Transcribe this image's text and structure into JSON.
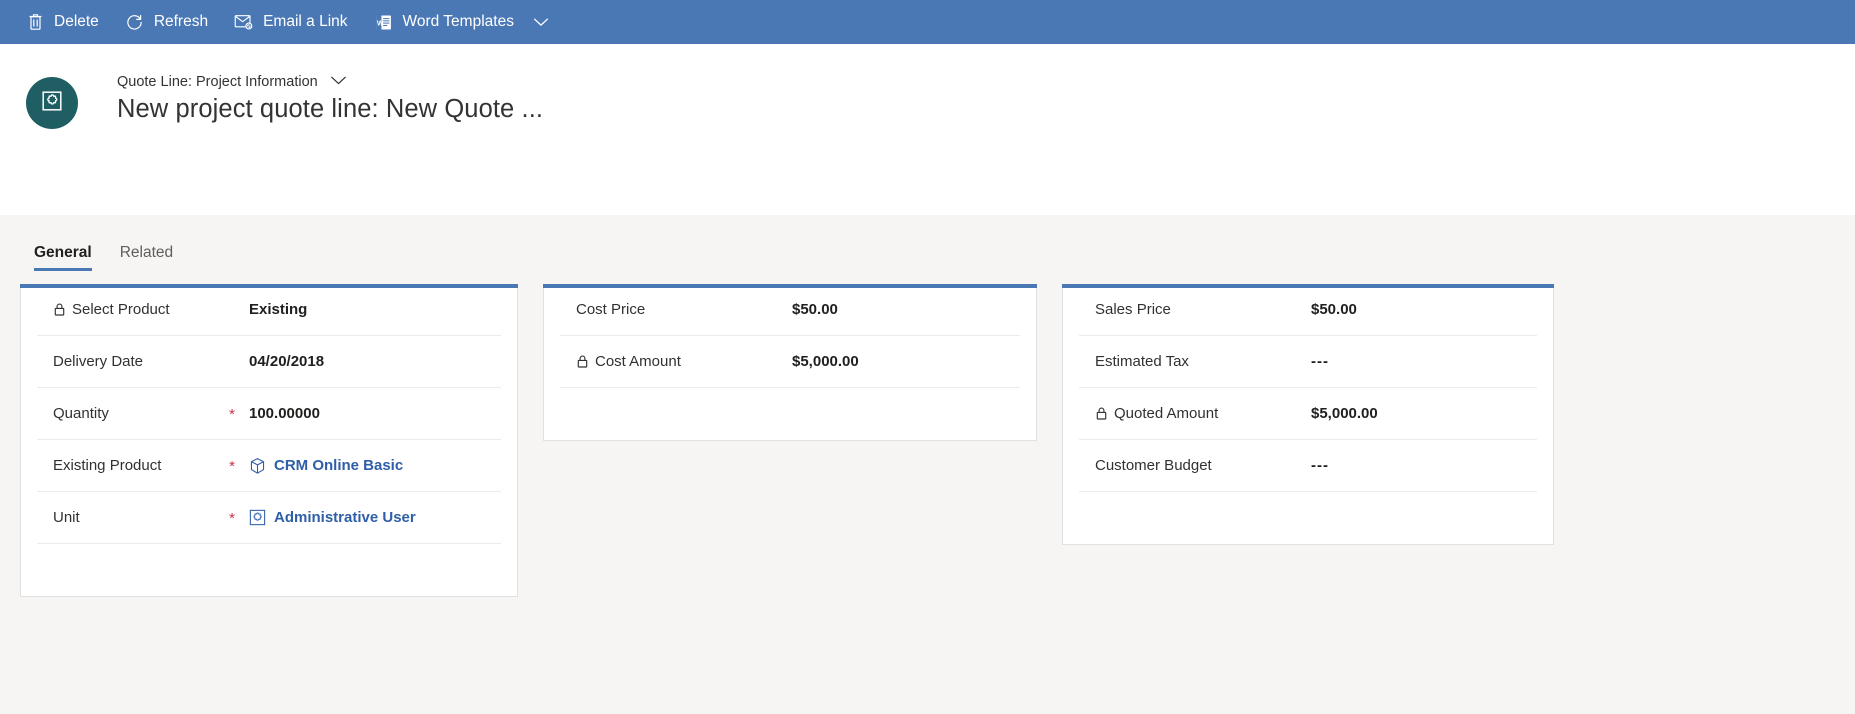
{
  "commandbar": {
    "background": "#4a78b5",
    "buttons": [
      {
        "icon": "trash-icon",
        "label": "Delete"
      },
      {
        "icon": "refresh-icon",
        "label": "Refresh"
      },
      {
        "icon": "email-link-icon",
        "label": "Email a Link"
      },
      {
        "icon": "word-templates-icon",
        "label": "Word Templates",
        "chevron": "chevron-down-icon"
      }
    ]
  },
  "header": {
    "avatar_icon": "unit-entity-icon",
    "avatar_color": "#1f5f64",
    "entity_label": "Quote Line: Project Information",
    "entity_chevron": "chevron-down-icon",
    "record_title": "New project quote line: New Quote ..."
  },
  "tabs": [
    {
      "label": "General",
      "active": true
    },
    {
      "label": "Related",
      "active": false
    }
  ],
  "accent_color": "#4a78b5",
  "required_color": "#c4314b",
  "link_color": "#2f5fa8",
  "cards": [
    {
      "name": "product-details-card",
      "fields": [
        {
          "label": "Select Product",
          "value": "Existing",
          "locked": true,
          "required": false,
          "type": "text"
        },
        {
          "label": "Delivery Date",
          "value": "04/20/2018",
          "locked": false,
          "required": false,
          "type": "text"
        },
        {
          "label": "Quantity",
          "value": "100.00000",
          "locked": false,
          "required": true,
          "type": "text"
        },
        {
          "label": "Existing Product",
          "value": "CRM Online Basic",
          "locked": false,
          "required": true,
          "type": "lookup",
          "icon": "product-box-icon"
        },
        {
          "label": "Unit",
          "value": "Administrative User",
          "locked": false,
          "required": true,
          "type": "lookup",
          "icon": "unit-entity-icon"
        }
      ],
      "trailing_blank_rows": 1
    },
    {
      "name": "cost-card",
      "fields": [
        {
          "label": "Cost Price",
          "value": "$50.00",
          "locked": false,
          "required": false,
          "type": "text"
        },
        {
          "label": "Cost Amount",
          "value": "$5,000.00",
          "locked": true,
          "required": false,
          "type": "text"
        }
      ],
      "trailing_blank_rows": 1
    },
    {
      "name": "pricing-card",
      "fields": [
        {
          "label": "Sales Price",
          "value": "$50.00",
          "locked": false,
          "required": false,
          "type": "text"
        },
        {
          "label": "Estimated Tax",
          "value": "---",
          "locked": false,
          "required": false,
          "type": "empty"
        },
        {
          "label": "Quoted Amount",
          "value": "$5,000.00",
          "locked": true,
          "required": false,
          "type": "text"
        },
        {
          "label": "Customer Budget",
          "value": "---",
          "locked": false,
          "required": false,
          "type": "empty"
        }
      ],
      "trailing_blank_rows": 1
    }
  ]
}
